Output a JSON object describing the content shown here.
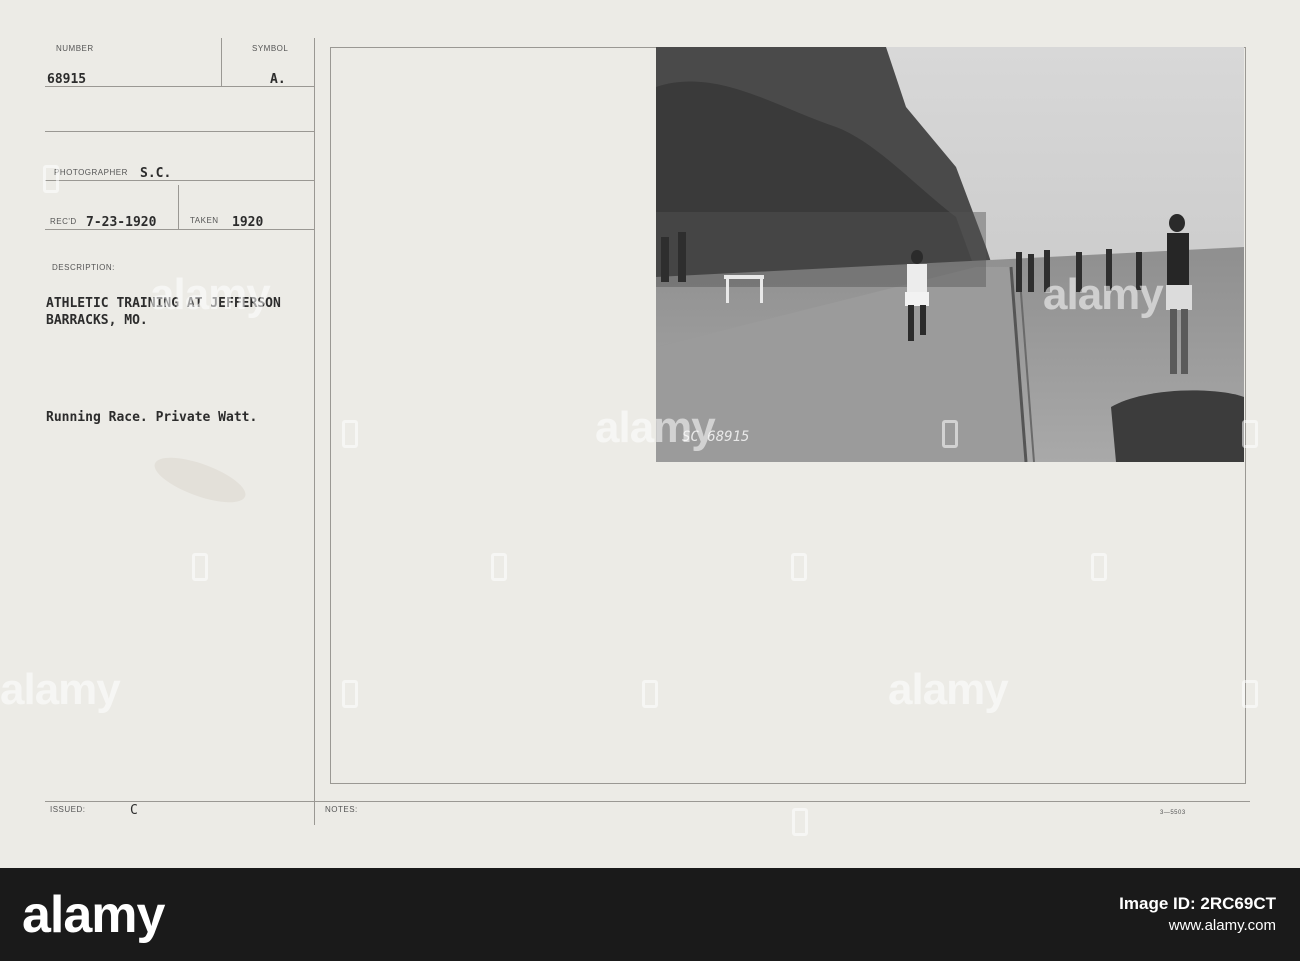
{
  "record": {
    "number_label": "NUMBER",
    "number": "68915",
    "symbol_label": "SYMBOL",
    "symbol": "A.",
    "photographer_label": "PHOTOGRAPHER",
    "photographer": "S.C.",
    "recd_label": "REC'D",
    "recd": "7-23-1920",
    "taken_label": "TAKEN",
    "taken": "1920",
    "description_label": "DESCRIPTION:",
    "description_line1": "ATHLETIC TRAINING AT JEFFERSON",
    "description_line2": "BARRACKS, MO.",
    "caption": "Running Race. Private Watt.",
    "issued_label": "ISSUED:",
    "issued": "C",
    "notes_label": "NOTES:",
    "form_code": "3—5503"
  },
  "photo": {
    "stamp": "SC 68915"
  },
  "watermark": {
    "text": "alamy"
  },
  "footer": {
    "logo": "alamy",
    "image_id_line1": "Image ID: 2RC69CT",
    "image_id_line2": "www.alamy.com"
  },
  "colors": {
    "card": "#ecebe6",
    "footer": "#1a1a1a",
    "ink": "#2c2c2c"
  }
}
